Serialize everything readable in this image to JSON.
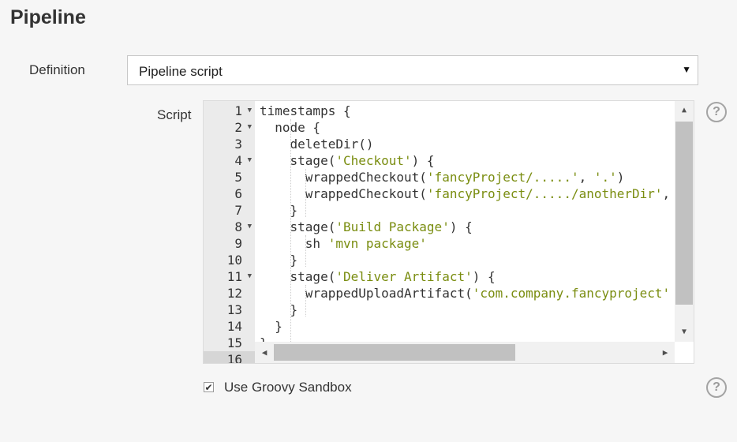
{
  "section": {
    "title": "Pipeline"
  },
  "definition": {
    "label": "Definition",
    "selected": "Pipeline script"
  },
  "script": {
    "label": "Script",
    "line_numbers": [
      "1",
      "2",
      "3",
      "4",
      "5",
      "6",
      "7",
      "8",
      "9",
      "10",
      "11",
      "12",
      "13",
      "14",
      "15",
      "16"
    ],
    "lines": [
      "timestamps {",
      "  node {",
      "    deleteDir()",
      "    stage('Checkout') {",
      "      wrappedCheckout('fancyProject/.....', '.')",
      "      wrappedCheckout('fancyProject/...../anotherDir',",
      "    }",
      "    stage('Build Package') {",
      "      sh 'mvn package'",
      "    }",
      "    stage('Deliver Artifact') {",
      "      wrappedUploadArtifact('com.company.fancyproject'",
      "    }",
      "  }",
      "}",
      ""
    ]
  },
  "sandbox": {
    "label": "Use Groovy Sandbox",
    "checked": true
  },
  "help": {
    "symbol": "?"
  },
  "icons": {
    "dropdown": "chevron-down-icon",
    "help": "help-icon",
    "check": "check-icon"
  }
}
